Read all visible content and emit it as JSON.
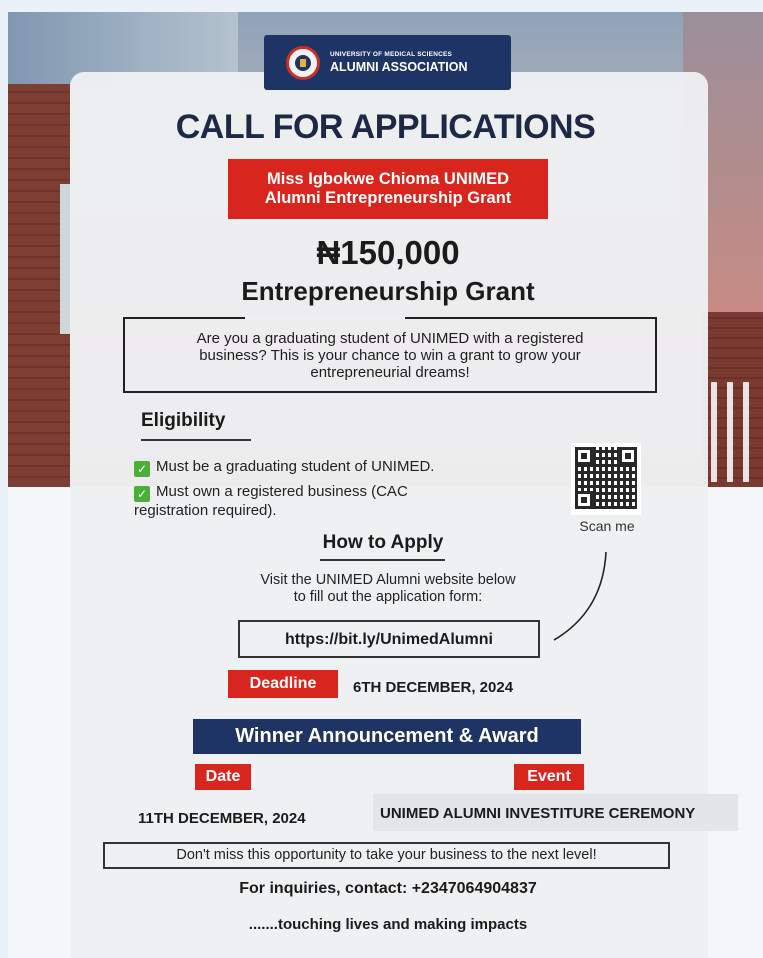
{
  "organization": {
    "line1": "UNIVERSITY OF MEDICAL SCIENCES",
    "line2": "ALUMNI ASSOCIATION"
  },
  "title": "CALL FOR APPLICATIONS",
  "grant_name": {
    "line1": "Miss Igbokwe Chioma UNIMED",
    "line2": "Alumni Entrepreneurship Grant"
  },
  "amount": "₦150,000",
  "amount_subtitle": "Entrepreneurship Grant",
  "intro": {
    "line1": "Are you a graduating student of UNIMED with a registered",
    "line2": "business? This is your chance to win a grant to grow your",
    "line3": "entrepreneurial dreams!"
  },
  "eligibility": {
    "heading": "Eligibility",
    "items": [
      {
        "line1": "Must be a graduating student of UNIMED.",
        "line2": ""
      },
      {
        "line1": "Must own a registered business (CAC",
        "line2": "registration required)."
      }
    ]
  },
  "qr": {
    "caption": "Scan me"
  },
  "how_to_apply": {
    "heading": "How to Apply",
    "line1": "Visit the UNIMED Alumni website below",
    "line2": "to fill out the application form:",
    "url": "https://bit.ly/UnimedAlumni"
  },
  "deadline": {
    "label": "Deadline",
    "date": "6TH DECEMBER, 2024"
  },
  "award": {
    "heading": "Winner Announcement & Award",
    "date_label": "Date",
    "event_label": "Event",
    "date_value": "11TH DECEMBER, 2024",
    "event_value": "UNIMED ALUMNI INVESTITURE CEREMONY"
  },
  "footer": {
    "call_to_action": "Don't miss this opportunity to take your business to the next level!",
    "inquiries": "For inquiries, contact: +2347064904837",
    "tagline": ".......touching lives and making impacts"
  },
  "colors": {
    "navy": "#1e3464",
    "red": "#d8261f",
    "check_green": "#4caf3a"
  }
}
